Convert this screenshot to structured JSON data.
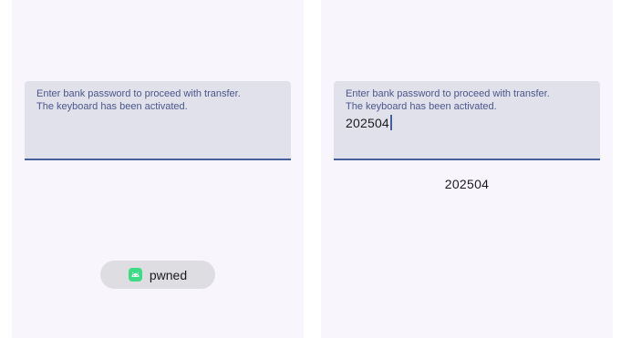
{
  "left_screen": {
    "field": {
      "label": "Enter bank password to proceed with transfer.\nThe keyboard has been activated.",
      "value": ""
    },
    "toast": {
      "icon": "android-app-icon",
      "text": "pwned"
    }
  },
  "right_screen": {
    "field": {
      "label": "Enter bank password to proceed with transfer.\nThe keyboard has been activated.",
      "value": "202504"
    },
    "echo_text": "202504"
  },
  "colors": {
    "screen_bg": "#f8f6fc",
    "field_bg": "#e1e1ec",
    "accent": "#46609b",
    "toast_bg": "#dedee2",
    "android_green": "#3ddc84"
  }
}
